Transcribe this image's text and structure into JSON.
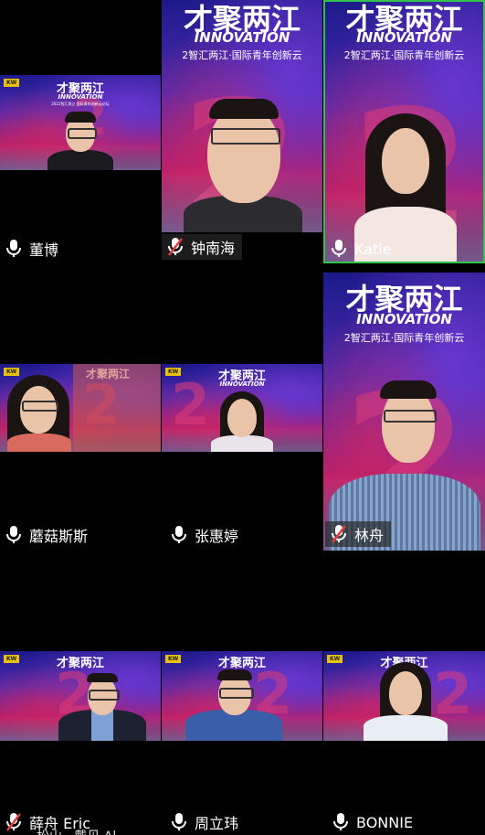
{
  "event": {
    "banner_en": "INNOVATION",
    "title_cn": "才聚两江",
    "subtitle_cn": "2智汇两江·国际青年创新云",
    "small_subtitle_cn": "2022智汇两江·国际青年创新云论坛",
    "year_digit": "2",
    "badge_text": "KW"
  },
  "participants": [
    {
      "id": "dongbo",
      "name": "董博",
      "mic": "on"
    },
    {
      "id": "zhongnanhai",
      "name": "钟南海",
      "mic": "muted"
    },
    {
      "id": "katie",
      "name": "Katie",
      "mic": "on",
      "active_speaker": true
    },
    {
      "id": "moguss",
      "name": "蘑菇斯斯",
      "mic": "on"
    },
    {
      "id": "zhanghuiting",
      "name": "张惠婷",
      "mic": "on"
    },
    {
      "id": "linzhou",
      "name": "林舟",
      "mic": "muted"
    },
    {
      "id": "xuezhou",
      "name": "薛舟 Eric",
      "mic": "muted"
    },
    {
      "id": "zhoulihui",
      "name": "周立玮",
      "mic": "on"
    },
    {
      "id": "bonnie",
      "name": "BONNIE",
      "mic": "on"
    }
  ],
  "overflow_text": "松山 · 戴见 Al",
  "colors": {
    "active": "#32c34b",
    "muted": "#e23b3b",
    "background": "#000000"
  }
}
